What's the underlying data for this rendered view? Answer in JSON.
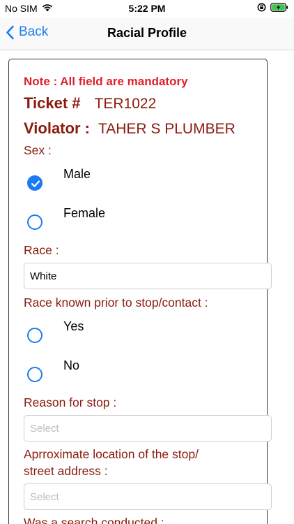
{
  "status_bar": {
    "carrier": "No SIM",
    "time": "5:22 PM"
  },
  "nav": {
    "back_label": "Back",
    "title": "Racial Profile"
  },
  "form": {
    "note": "Note : All field are mandatory",
    "ticket_label": "Ticket #",
    "ticket_value": "TER1022",
    "violator_label": "Violator :",
    "violator_value": "TAHER S PLUMBER",
    "sex_label": "Sex :",
    "sex_options": [
      {
        "label": "Male",
        "checked": true
      },
      {
        "label": "Female",
        "checked": false
      }
    ],
    "race_label": "Race :",
    "race_value": "White",
    "race_known_label": "Race known prior to stop/contact :",
    "race_known_options": [
      {
        "label": "Yes",
        "checked": false
      },
      {
        "label": "No",
        "checked": false
      }
    ],
    "reason_label": "Reason for stop :",
    "reason_placeholder": "Select",
    "location_label_line1": "Aprroximate location of the stop/",
    "location_label_line2": "street address :",
    "location_placeholder": "Select",
    "search_label": "Was a search conducted :"
  },
  "colors": {
    "accent": "#1a7bf2",
    "label": "#8b1a0e",
    "note": "#e0202a"
  }
}
